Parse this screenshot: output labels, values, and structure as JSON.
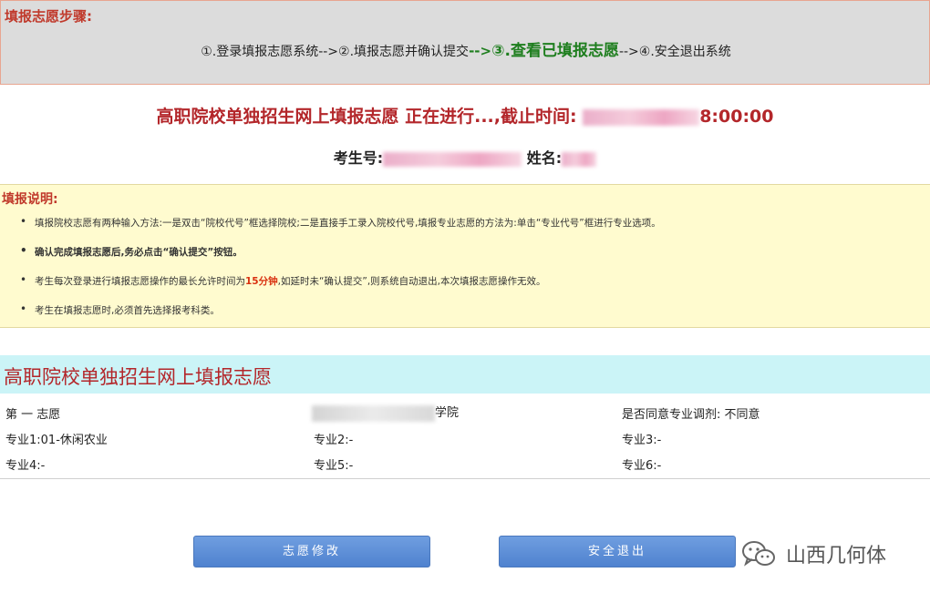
{
  "steps": {
    "title": "填报志愿步骤:",
    "s1": "①.登录填报志愿系统-->",
    "s2": "②.填报志愿并确认提交",
    "arrow": "-->",
    "s3": "③.查看已填报志愿",
    "s4": "-->④.安全退出系统"
  },
  "banner": {
    "text": "高职院校单独招生网上填报志愿 正在进行...,截止时间:",
    "time_tail": "8:00:00"
  },
  "student": {
    "id_label": "考生号:",
    "name_label": "姓名:"
  },
  "notes": {
    "title": "填报说明:",
    "item1": "填报院校志愿有两种输入方法:一是双击“院校代号”框选择院校;二是直接手工录入院校代号,填报专业志愿的方法为:单击“专业代号”框进行专业选项。",
    "item2": "确认完成填报志愿后,务必点击“确认提交”按钮。",
    "item3_pre": "考生每次登录进行填报志愿操作的最长允许时间为",
    "item3_red": "15分钟",
    "item3_post": ",如延时未“确认提交”,则系统自动退出,本次填报志愿操作无效。",
    "item4": "考生在填报志愿时,必须首先选择报考科类。"
  },
  "form": {
    "title": "高职院校单独招生网上填报志愿",
    "choice": "第 一 志愿",
    "school_suffix": "学院",
    "adjust": "是否同意专业调剂: 不同意",
    "m1": "专业1:01-休闲农业",
    "m2": "专业2:-",
    "m3": "专业3:-",
    "m4": "专业4:-",
    "m5": "专业5:-",
    "m6": "专业6:-"
  },
  "buttons": {
    "modify": "志愿修改",
    "logout": "安全退出"
  },
  "watermark": {
    "text": "山西几何体"
  }
}
